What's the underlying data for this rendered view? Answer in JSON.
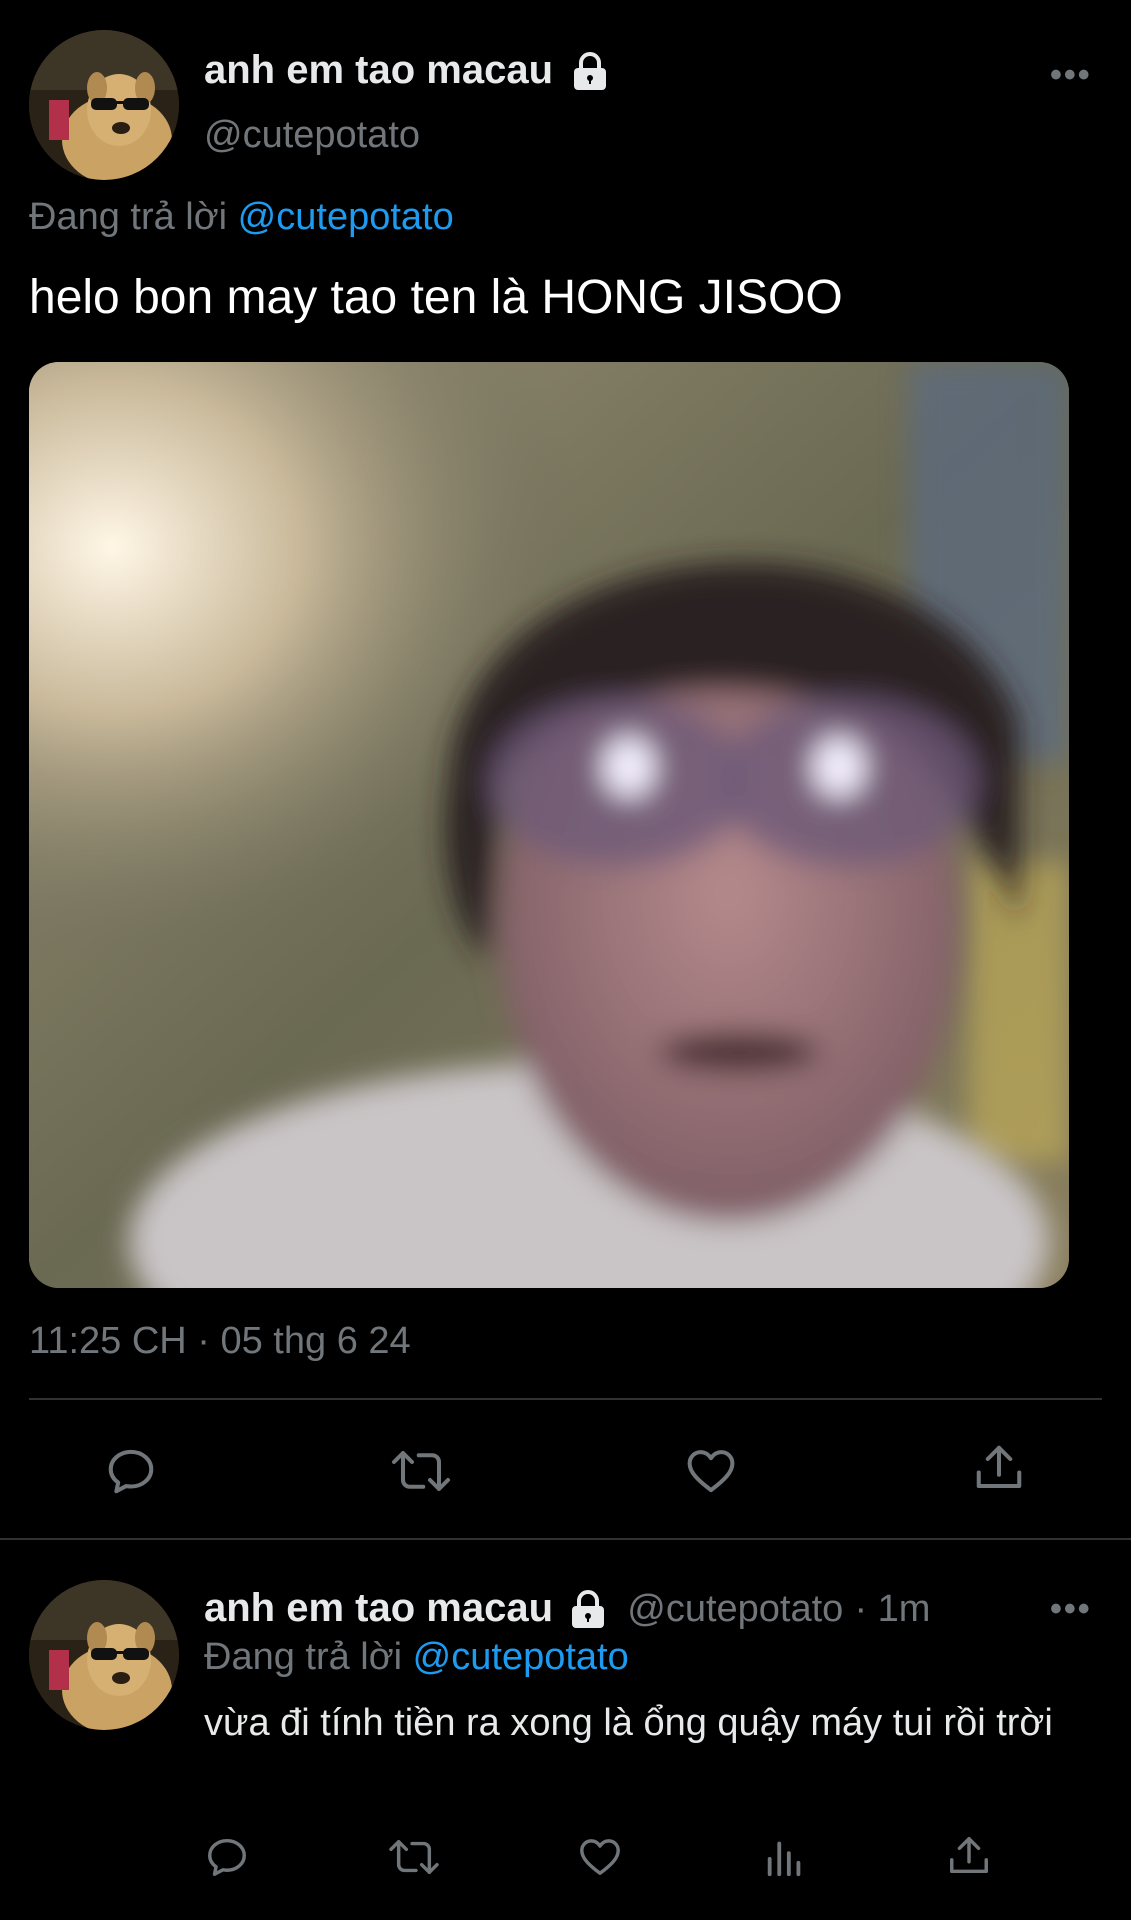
{
  "main_tweet": {
    "avatar_icon": "dog-with-sunglasses-avatar",
    "display_name": "anh em tao macau",
    "handle": "@cutepotato",
    "reply_prefix": "Đang trả lời",
    "reply_to": "@cutepotato",
    "text": "helo bon may tao ten là HONG JISOO",
    "timestamp": "11:25 CH · 05 thg 6 24",
    "actions": [
      "reply-icon",
      "retweet-icon",
      "like-icon",
      "share-icon"
    ]
  },
  "reply_tweet": {
    "avatar_icon": "dog-with-sunglasses-avatar",
    "display_name": "anh em tao macau",
    "handle": "@cutepotato",
    "time": "· 1m",
    "reply_prefix": "Đang trả lời",
    "reply_to": "@cutepotato",
    "text": "vừa đi tính tiền ra xong là ổng quậy máy tui rồi trời",
    "actions": [
      "reply-icon",
      "retweet-icon",
      "like-icon",
      "analytics-icon",
      "share-icon"
    ]
  },
  "colors": {
    "background": "#000000",
    "text": "#e7e9ea",
    "muted": "#71767b",
    "link": "#1d9bf0",
    "divider": "#2f3336"
  }
}
